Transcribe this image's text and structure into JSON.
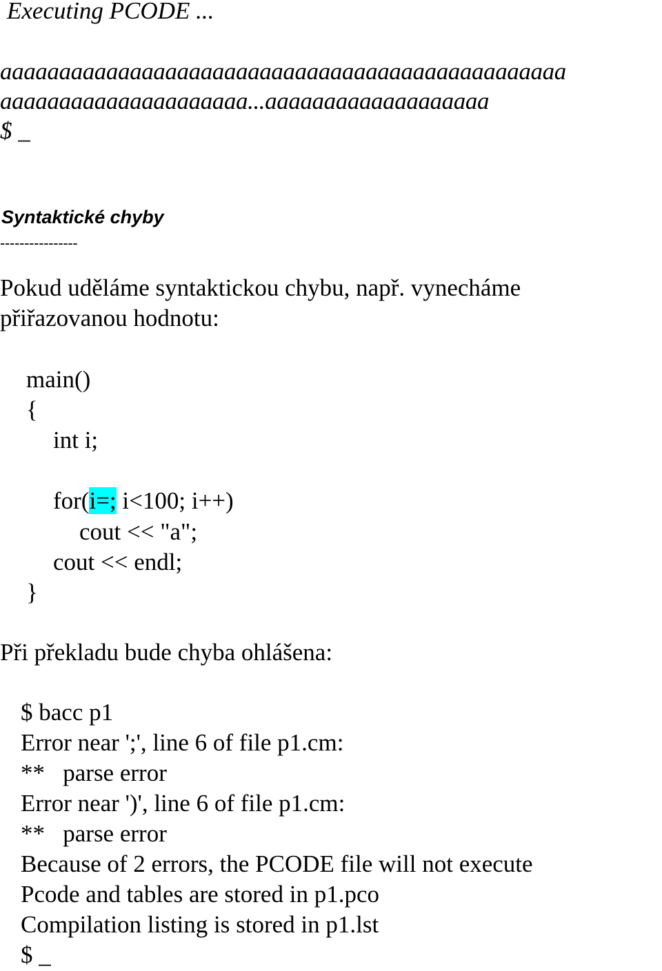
{
  "terminal_output": {
    "executing": "Executing PCODE ...",
    "output_line_1": "aaaaaaaaaaaaaaaaaaaaaaaaaaaaaaaaaaaaaaaaaaaaaaaa",
    "output_line_2": "aaaaaaaaaaaaaaaaaaaaa...aaaaaaaaaaaaaaaaaaa",
    "prompt": "$ _"
  },
  "section": {
    "heading": "Syntaktické chyby",
    "underline": "----------------"
  },
  "intro": {
    "line_1": "Pokud uděláme syntaktickou chybu, např. vynecháme",
    "line_2": "přiřazovanou hodnotu:"
  },
  "code": {
    "lines": [
      "main()",
      "{",
      "int i;",
      "",
      "for(",
      "i=;",
      " i<100; i++)",
      "cout << \"a\";",
      "cout << endl;",
      "}"
    ],
    "highlight_color": "#00ffff"
  },
  "report_intro": "Při překladu bude chyba ohlášena:",
  "compiler_output": [
    "$ bacc p1",
    "Error near ';', line 6 of file p1.cm:",
    "**   parse error",
    "Error near ')', line 6 of file p1.cm:",
    "**   parse error",
    "Because of 2 errors, the PCODE file will not execute",
    "Pcode and tables are stored in p1.pco",
    "Compilation listing is stored in p1.lst",
    "$ _"
  ]
}
